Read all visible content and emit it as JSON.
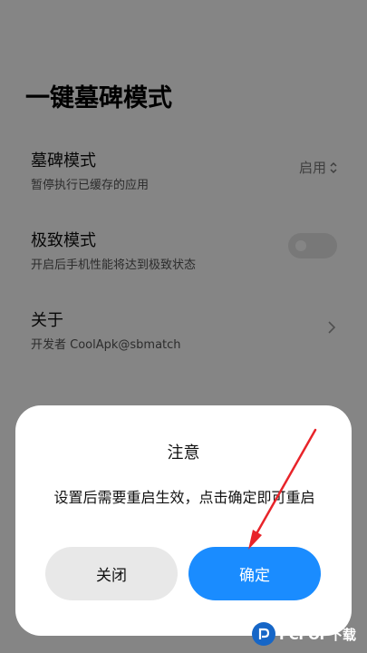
{
  "page": {
    "title": "一键墓碑模式"
  },
  "settings": [
    {
      "title": "墓碑模式",
      "description": "暂停执行已缓存的应用",
      "value": "启用"
    },
    {
      "title": "极致模式",
      "description": "开启后手机性能将达到极致状态",
      "toggle_on": false
    },
    {
      "title": "关于",
      "description": "开发者 CoolApk@sbmatch"
    }
  ],
  "dialog": {
    "title": "注意",
    "message": "设置后需要重启生效，点击确定即可重启",
    "cancel_label": "关闭",
    "confirm_label": "确定"
  },
  "watermark": {
    "text": "PCPOP下载"
  },
  "colors": {
    "accent": "#1a8cff",
    "annotation_arrow": "#e8242a",
    "watermark_logo": "#1666c7"
  },
  "icons": [
    "updown-icon",
    "chevron-right-icon",
    "pcpop-logo-icon"
  ]
}
